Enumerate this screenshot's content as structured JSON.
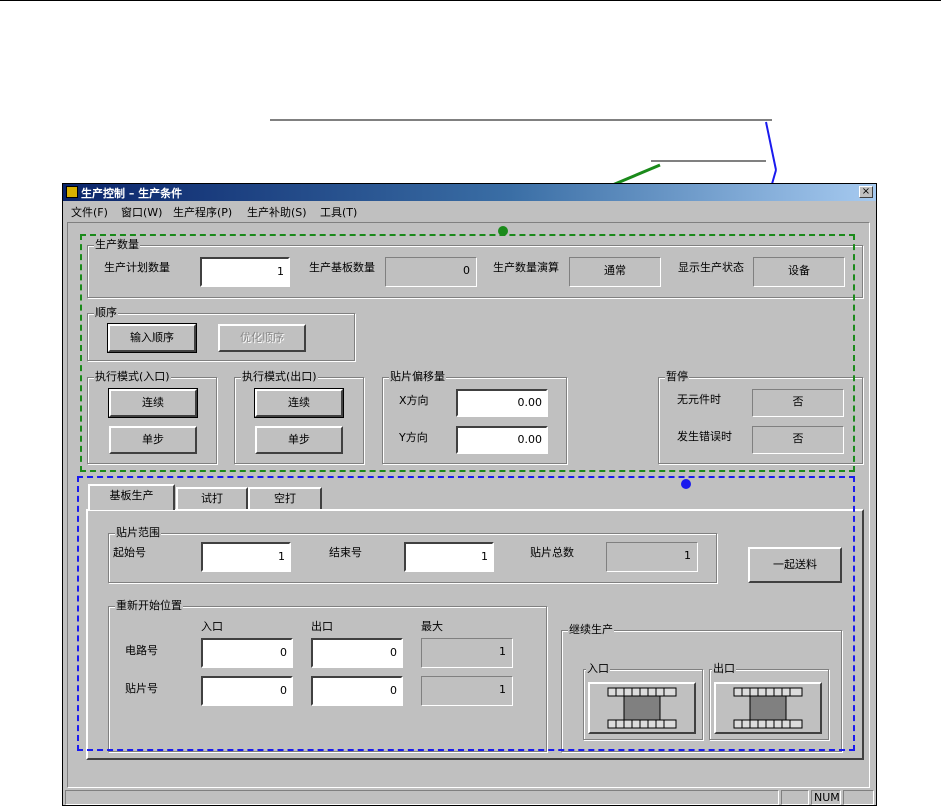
{
  "window": {
    "title": "生产控制 – 生产条件",
    "close_glyph": "×"
  },
  "menu": [
    "文件(F)",
    "窗口(W)",
    "生产程序(P)",
    "生产补助(S)",
    "工具(T)"
  ],
  "production_count": {
    "group_label": "生产数量",
    "planned_label": "生产计划数量",
    "planned_value": "1",
    "board_count_label": "生产基板数量",
    "board_count_value": "0",
    "calc_label": "生产数量演算",
    "calc_value": "通常",
    "status_label": "显示生产状态",
    "status_value": "设备"
  },
  "sequence": {
    "group_label": "顺序",
    "input_button": "输入顺序",
    "optimize_button": "优化顺序"
  },
  "mode_in": {
    "group_label": "执行模式(入口)",
    "continuous": "连续",
    "single": "单步"
  },
  "mode_out": {
    "group_label": "执行模式(出口)",
    "continuous": "连续",
    "single": "单步"
  },
  "offset": {
    "group_label": "贴片偏移量",
    "x_label": "X方向",
    "x_value": "0.00",
    "y_label": "Y方向",
    "y_value": "0.00"
  },
  "pause": {
    "group_label": "暂停",
    "no_component_label": "无元件时",
    "no_component_value": "否",
    "error_label": "发生错误时",
    "error_value": "否"
  },
  "tabs": [
    "基板生产",
    "试打",
    "空打"
  ],
  "placement_range": {
    "group_label": "贴片范围",
    "start_label": "起始号",
    "start_value": "1",
    "end_label": "结束号",
    "end_value": "1",
    "total_label": "贴片总数",
    "total_value": "1",
    "feed_button": "一起送料"
  },
  "restart": {
    "group_label": "重新开始位置",
    "col_in": "入口",
    "col_out": "出口",
    "col_max": "最大",
    "circuit_label": "电路号",
    "circuit_in": "0",
    "circuit_out": "0",
    "circuit_max": "1",
    "placement_label": "贴片号",
    "placement_in": "0",
    "placement_out": "0",
    "placement_max": "1"
  },
  "continue": {
    "group_label": "继续生产",
    "in_label": "入口",
    "out_label": "出口"
  },
  "statusbar": {
    "num": "NUM"
  },
  "colors": {
    "green_annotation": "#1a8a1a",
    "blue_annotation": "#1a1aee",
    "face": "#c0c0c0"
  }
}
